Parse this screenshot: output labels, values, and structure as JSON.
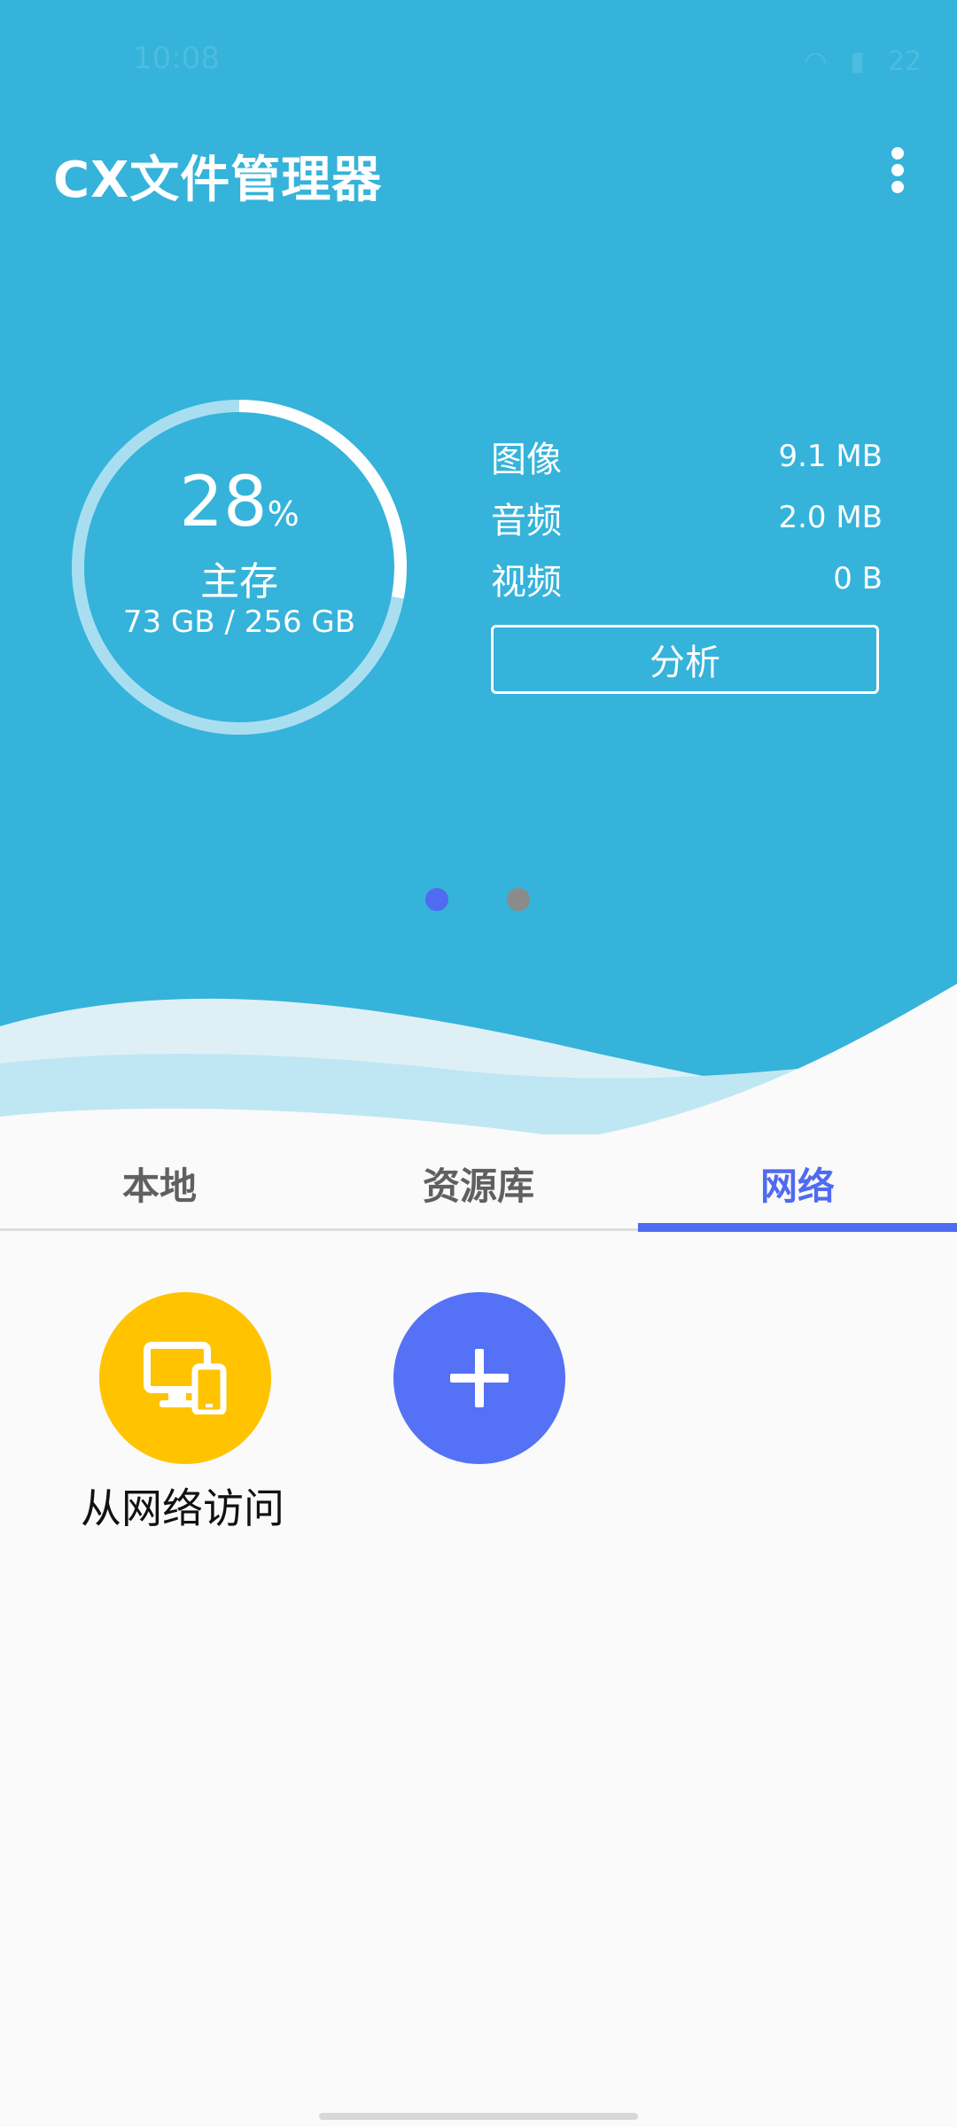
{
  "status_bar": {
    "time": "10:08",
    "battery": "22"
  },
  "header": {
    "title": "CX文件管理器"
  },
  "storage": {
    "percent": "28",
    "percent_unit": "%",
    "label": "主存",
    "usage": "73 GB / 256 GB",
    "used_fraction": 0.28
  },
  "stats": [
    {
      "label": "图像",
      "value": "9.1 MB"
    },
    {
      "label": "音频",
      "value": "2.0 MB"
    },
    {
      "label": "视频",
      "value": "0 B"
    }
  ],
  "analyze_button": {
    "label": "分析"
  },
  "tabs": [
    {
      "label": "本地",
      "active": false
    },
    {
      "label": "资源库",
      "active": false
    },
    {
      "label": "网络",
      "active": true
    }
  ],
  "network": {
    "items": [
      {
        "label": "从网络访问",
        "icon": "devices-icon"
      }
    ],
    "add_icon": "plus-icon"
  },
  "colors": {
    "hero_bg": "#35b3da",
    "accent": "#4f6bf1",
    "network_item": "#ffc300",
    "add_button": "#5571f5"
  }
}
